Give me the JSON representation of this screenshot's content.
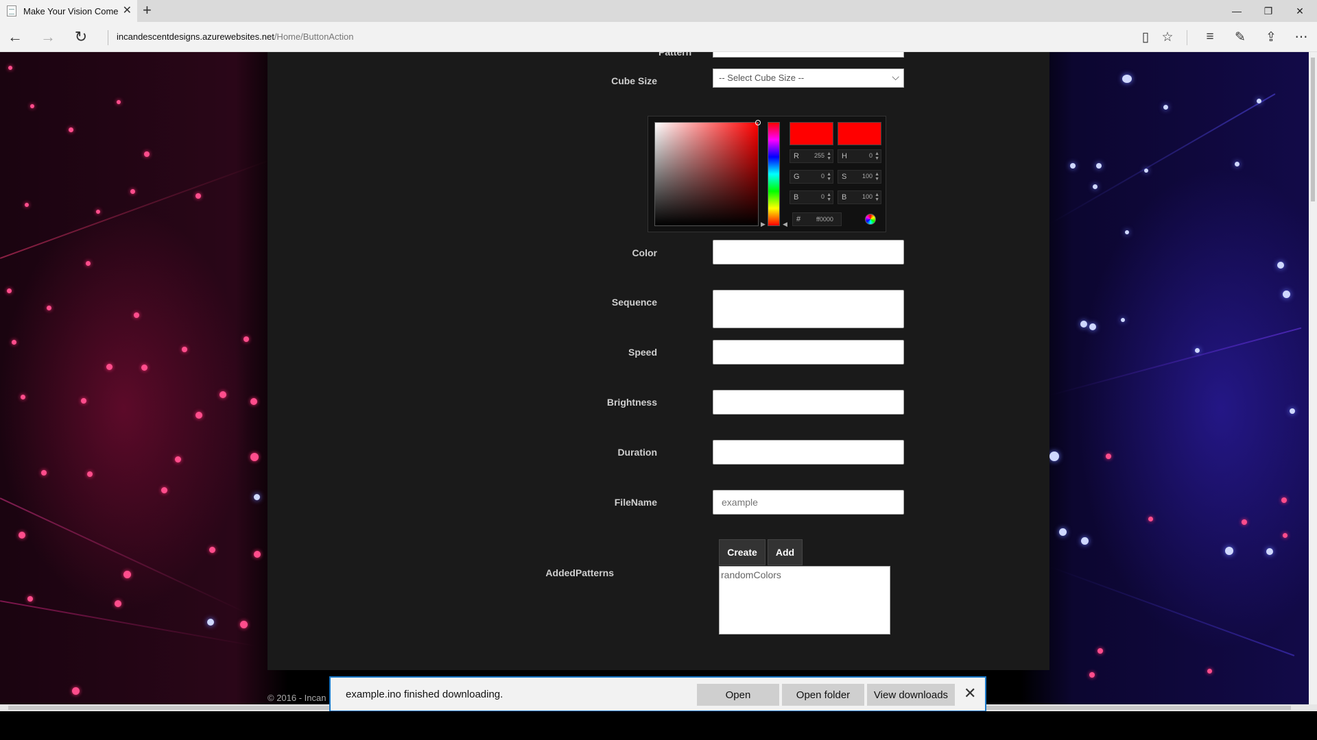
{
  "browser": {
    "tab_title": "Make Your Vision Come",
    "address_domain": "incandescentdesigns.azurewebsites.net",
    "address_path": "/Home/ButtonAction"
  },
  "form": {
    "pattern_label": "Pattern",
    "cube_size_label": "Cube Size",
    "cube_size_value": "-- Select Cube Size --",
    "color_label": "Color",
    "sequence_label": "Sequence",
    "speed_label": "Speed",
    "brightness_label": "Brightness",
    "duration_label": "Duration",
    "filename_label": "FileName",
    "filename_placeholder": "example",
    "create_button": "Create",
    "add_button": "Add",
    "added_patterns_label": "AddedPatterns",
    "added_patterns_value": "randomColors"
  },
  "color_picker": {
    "r_label": "R",
    "r_value": "255",
    "g_label": "G",
    "g_value": "0",
    "b_label": "B",
    "b_value": "0",
    "h_label": "H",
    "h_value": "0",
    "s_label": "S",
    "s_value": "100",
    "br_label": "B",
    "br_value": "100",
    "hex_label": "#",
    "hex_value": "ff0000",
    "current_color": "#ff0000",
    "new_color": "#ff0000"
  },
  "footer": {
    "copyright": "© 2016 - Incan"
  },
  "download_bar": {
    "message": "example.ino finished downloading.",
    "open_button": "Open",
    "open_folder_button": "Open folder",
    "view_downloads_button": "View downloads"
  }
}
